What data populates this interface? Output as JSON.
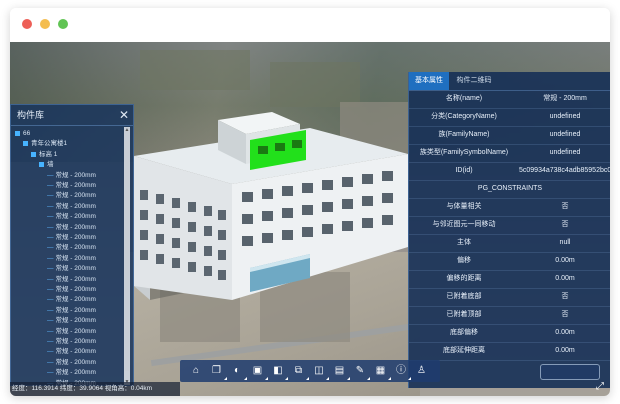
{
  "window": {
    "traffic_lights": [
      {
        "name": "close",
        "color": "#ed5f57"
      },
      {
        "name": "minimize",
        "color": "#f4bd4f"
      },
      {
        "name": "maximize",
        "color": "#61c454"
      }
    ]
  },
  "component_panel": {
    "title": "构件库",
    "close_label": "✕",
    "tree": [
      {
        "label": "66",
        "level": 0,
        "toggle": true
      },
      {
        "label": "青年公寓楼1",
        "level": 1,
        "toggle": true
      },
      {
        "label": "标高 1",
        "level": 2,
        "toggle": true
      },
      {
        "label": "墙",
        "level": 3,
        "toggle": true
      },
      {
        "label": "常规 - 200mm",
        "level": 4
      },
      {
        "label": "常规 - 200mm",
        "level": 4
      },
      {
        "label": "常规 - 200mm",
        "level": 4
      },
      {
        "label": "常规 - 200mm",
        "level": 4
      },
      {
        "label": "常规 - 200mm",
        "level": 4
      },
      {
        "label": "常规 - 200mm",
        "level": 4
      },
      {
        "label": "常规 - 200mm",
        "level": 4
      },
      {
        "label": "常规 - 200mm",
        "level": 4
      },
      {
        "label": "常规 - 200mm",
        "level": 4
      },
      {
        "label": "常规 - 200mm",
        "level": 4
      },
      {
        "label": "常规 - 200mm",
        "level": 4
      },
      {
        "label": "常规 - 200mm",
        "level": 4
      },
      {
        "label": "常规 - 200mm",
        "level": 4
      },
      {
        "label": "常规 - 200mm",
        "level": 4
      },
      {
        "label": "常规 - 200mm",
        "level": 4
      },
      {
        "label": "常规 - 200mm",
        "level": 4
      },
      {
        "label": "常规 - 200mm",
        "level": 4
      },
      {
        "label": "常规 - 200mm",
        "level": 4
      },
      {
        "label": "常规 - 200mm",
        "level": 4
      },
      {
        "label": "常规 - 200mm",
        "level": 4
      },
      {
        "label": "常规 - 200mm",
        "level": 4
      },
      {
        "label": "常规 - 200mm",
        "level": 4
      },
      {
        "label": "常规 - 200mm",
        "level": 4
      },
      {
        "label": "常规 - 200mm",
        "level": 4
      }
    ]
  },
  "properties_panel": {
    "tabs": [
      "基本属性",
      "构件二维码"
    ],
    "active_tab": 0,
    "basic": [
      {
        "key": "名称(name)",
        "value": "常规 - 200mm"
      },
      {
        "key": "分类(CategoryName)",
        "value": "undefined"
      },
      {
        "key": "族(FamilyName)",
        "value": "undefined"
      },
      {
        "key": "族类型(FamilySymbolName)",
        "value": "undefined"
      },
      {
        "key": "ID(id)",
        "value": "5c09934a738c4adb85952bc09"
      }
    ],
    "section_title": "PG_CONSTRAINTS",
    "constraints": [
      {
        "key": "与体量相关",
        "value": "否"
      },
      {
        "key": "与邻近图元一同移动",
        "value": "否"
      },
      {
        "key": "主体",
        "value": "null"
      },
      {
        "key": "偏移",
        "value": "0.00m"
      },
      {
        "key": "偏移的距离",
        "value": "0.00m"
      },
      {
        "key": "已附着底部",
        "value": "否"
      },
      {
        "key": "已附着顶部",
        "value": "否"
      },
      {
        "key": "底部偏移",
        "value": "0.00m"
      },
      {
        "key": "底部延伸距离",
        "value": "0.00m"
      }
    ]
  },
  "toolbar": {
    "buttons": [
      {
        "name": "home-icon",
        "glyph": "⌂"
      },
      {
        "name": "copy-icon",
        "glyph": "❐"
      },
      {
        "name": "color-icon",
        "glyph": "◐"
      },
      {
        "name": "section-box-icon",
        "glyph": "▣"
      },
      {
        "name": "frame-icon",
        "glyph": "◧"
      },
      {
        "name": "clip-icon",
        "glyph": "⧉"
      },
      {
        "name": "split-icon",
        "glyph": "◫"
      },
      {
        "name": "layers-icon",
        "glyph": "▤"
      },
      {
        "name": "measure-icon",
        "glyph": "✎"
      },
      {
        "name": "save-icon",
        "glyph": "▦"
      },
      {
        "name": "info-icon",
        "glyph": "ⓘ"
      },
      {
        "name": "walk-icon",
        "glyph": "♙"
      }
    ]
  },
  "status_bar": {
    "text": "经度：116.3914 纬度：39.9064  视角高：0.04km"
  },
  "fullscreen": {
    "glyph": "⤢"
  },
  "colors": {
    "highlight": "#22e01b",
    "panel": "#183460",
    "active_tab": "#1f6fc0"
  }
}
